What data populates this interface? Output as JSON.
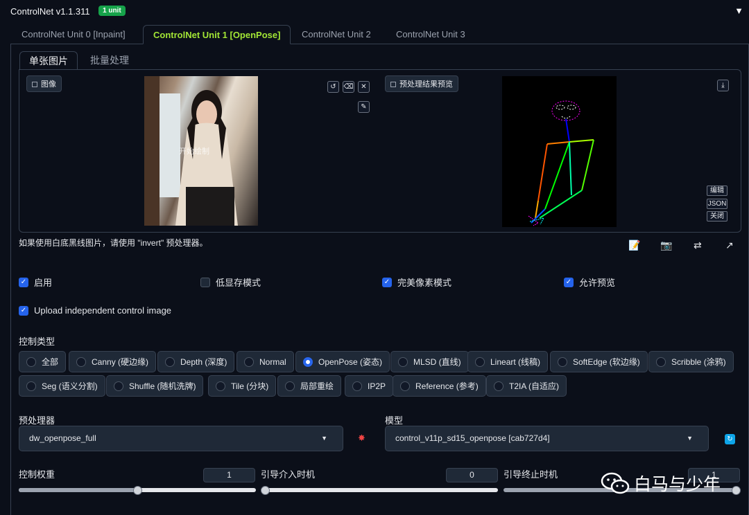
{
  "header": {
    "title": "ControlNet v1.1.311",
    "badge": "1 unit",
    "collapse_icon": "▼"
  },
  "unit_tabs": [
    "ControlNet Unit 0 [Inpaint]",
    "ControlNet Unit 1 [OpenPose]",
    "ControlNet Unit 2",
    "ControlNet Unit 3"
  ],
  "sub_tabs": [
    "单张图片",
    "批量处理"
  ],
  "image_panel": {
    "label": "图像",
    "overlay_text": "开始绘制"
  },
  "preview_panel": {
    "label": "预处理结果预览",
    "side_buttons": [
      "编辑",
      "JSON",
      "关闭"
    ]
  },
  "hint": "如果使用白底黑线图片，请使用 \"invert\" 预处理器。",
  "checkboxes": [
    {
      "label": "启用",
      "checked": true
    },
    {
      "label": "低显存模式",
      "checked": false
    },
    {
      "label": "完美像素模式",
      "checked": true
    },
    {
      "label": "允许预览",
      "checked": true
    },
    {
      "label": "Upload independent control image",
      "checked": true
    }
  ],
  "control_type": {
    "label": "控制类型",
    "selected": "OpenPose (姿态)",
    "row1": [
      "全部",
      "Canny (硬边缘)",
      "Depth (深度)",
      "Normal",
      "OpenPose (姿态)",
      "MLSD (直线)",
      "Lineart (线稿)",
      "SoftEdge (软边缘)",
      "Scribble (涂鸦)"
    ],
    "row2": [
      "Seg (语义分割)",
      "Shuffle (随机洗牌)",
      "Tile (分块)",
      "局部重绘",
      "IP2P",
      "Reference (参考)",
      "T2IA (自适应)"
    ]
  },
  "preprocessor": {
    "label": "预处理器",
    "value": "dw_openpose_full"
  },
  "model": {
    "label": "模型",
    "value": "control_v11p_sd15_openpose [cab727d4]"
  },
  "sliders": {
    "weight": {
      "label": "控制权重",
      "value": "1",
      "fraction": 0.5
    },
    "start": {
      "label": "引导介入时机",
      "value": "0",
      "fraction": 0.0
    },
    "end": {
      "label": "引导终止时机",
      "value": "1",
      "fraction": 1.0
    }
  },
  "watermark": "白马与少年",
  "colors": {
    "accent": "#2563eb",
    "active_tab": "#a3e635",
    "badge": "#16a34a",
    "bg": "#0b0f19"
  }
}
